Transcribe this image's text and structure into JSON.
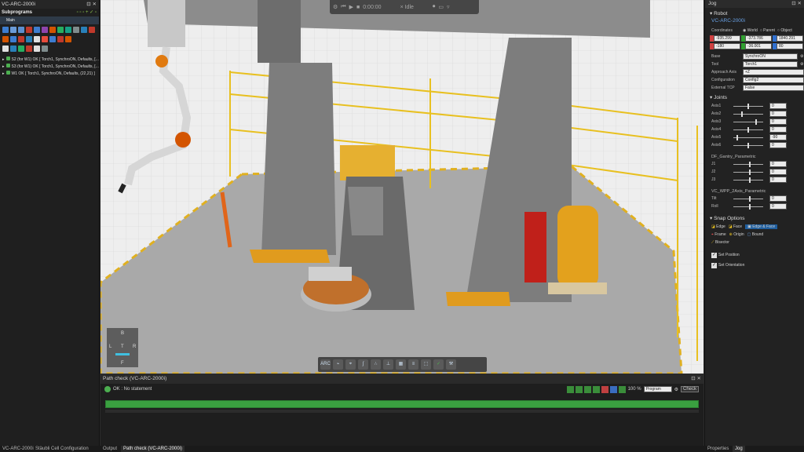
{
  "left_panel": {
    "title": "VC-ARC-2000i",
    "subprograms_label": "Subprograms",
    "main_label": "Main",
    "statements": [
      "S2 (for W1) OK  [ Torch1, SynchroON, Defaults, [...",
      "S3 (for W1) OK  [ Torch1, SynchroON, Defaults, [...",
      "W1 OK  [ Torch1, SynchroON, Defaults, (22,21) ]"
    ]
  },
  "viewport": {
    "time": "0:00:00",
    "speed": "× Idle",
    "nav_cube": {
      "top": "B",
      "left": "L",
      "center": "T",
      "right": "R",
      "bottom": "F"
    },
    "toolbar_first": "ARC"
  },
  "jog": {
    "title": "Jog",
    "robot_section": "Robot",
    "robot_name": "VC-ARC-2000i",
    "coordinates_label": "Coordinates",
    "coord_options": [
      "World",
      "Parent",
      "Object"
    ],
    "x": "-935.299",
    "y": "-373.786",
    "z": "1840.291",
    "rx": "-180",
    "ry": "-36.001",
    "rz": "80",
    "fields": [
      {
        "label": "Base",
        "value": "SynchroON"
      },
      {
        "label": "Tool",
        "value": "Torch1"
      },
      {
        "label": "Approach Axis",
        "value": "+Z"
      },
      {
        "label": "Configuration",
        "value": "Config2"
      },
      {
        "label": "External TCP",
        "value": "False"
      }
    ],
    "joints_section": "Joints",
    "joints": [
      {
        "label": "Axis1",
        "value": "0"
      },
      {
        "label": "Axis2",
        "value": "0"
      },
      {
        "label": "Axis3",
        "value": "0"
      },
      {
        "label": "Axis4",
        "value": "0"
      },
      {
        "label": "Axis5",
        "value": "-90"
      },
      {
        "label": "Axis6",
        "value": "0"
      }
    ],
    "gantry_title": "DF_Gantry_Parametric",
    "gantry_joints": [
      {
        "label": "J1",
        "value": "0"
      },
      {
        "label": "J2",
        "value": "0"
      },
      {
        "label": "J3",
        "value": "0"
      }
    ],
    "wpp_title": "VC_WPP_2Axis_Parametric",
    "wpp_joints": [
      {
        "label": "Tilt",
        "value": "0"
      },
      {
        "label": "Roll",
        "value": "0"
      }
    ],
    "snap_section": "Snap Options",
    "snap": [
      "Edge",
      "Face",
      "Edge & Face",
      "Frame",
      "Origin",
      "Bound",
      "Bisector"
    ],
    "set_position": "Set Position",
    "set_orientation": "Set Orientation"
  },
  "path_check": {
    "title": "Path check (VC-ARC-2000i)",
    "status": "OK :  No statement",
    "zoom": "100 %",
    "mode": "Program",
    "check_label": "Check"
  },
  "tabs": {
    "left": [
      "VC-ARC-2000i",
      "Stäubli Cell Configuration"
    ],
    "bottom": [
      "Output",
      "Path check (VC-ARC-2000i)"
    ],
    "right": [
      "Properties",
      "Jog"
    ]
  }
}
